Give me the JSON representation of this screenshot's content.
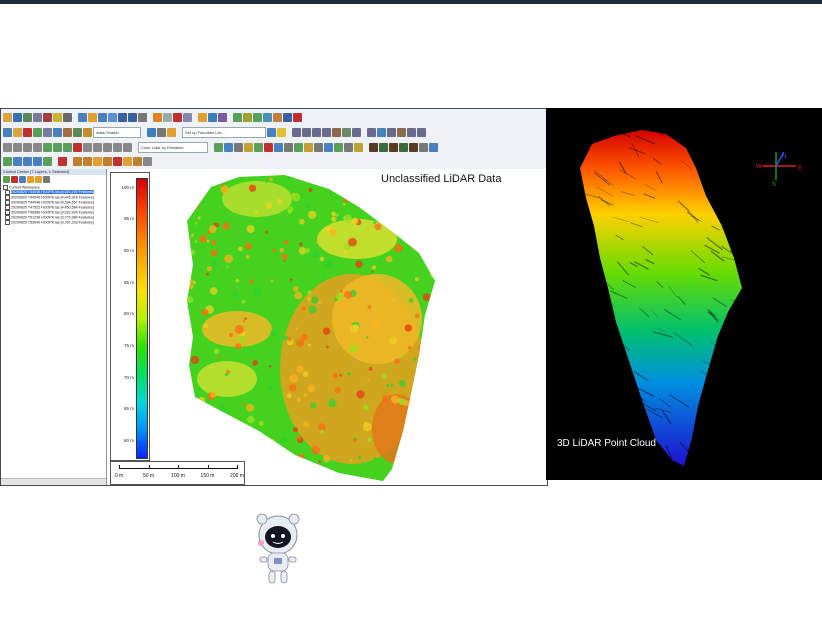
{
  "toolbar": {
    "style_select": "Atlas Shader",
    "favorites_select": "Set up Favorites List...",
    "color_select": "Color Lidar by Elevation"
  },
  "control_center": {
    "title": "Control Center [7 Layers, 1 Selected]",
    "workspace": "Current Workspace",
    "layers": [
      {
        "label": "20200820 T44046 HOOPK.las [4,520,160 Features]",
        "selected": true
      },
      {
        "label": "20200820 T44046 HOOPK.las [4,445,918 Features]",
        "selected": false
      },
      {
        "label": "20200820 T44046 HOOPK.las [4,594,557 Features]",
        "selected": false
      },
      {
        "label": "20200820 T47522 HOOPK.las [4,450,584 Features]",
        "selected": false
      },
      {
        "label": "20200820 T48366 HOOPK.las [3,032,924 Features]",
        "selected": false
      },
      {
        "label": "20200820 T51236 HOOPK.las [3,770,984 Features]",
        "selected": false
      },
      {
        "label": "20200820 T53040 HOOPK.las [3,767,233 Features]",
        "selected": false
      }
    ]
  },
  "map": {
    "title": "Unclassified LiDAR Data",
    "legend_ticks": [
      "100 m",
      "95 m",
      "90 m",
      "85 m",
      "80 m",
      "75 m",
      "70 m",
      "65 m",
      "60 m"
    ],
    "legend_values": [
      100,
      95,
      90,
      85,
      80,
      75,
      70,
      65,
      60
    ],
    "scale_labels": [
      "0 m",
      "50 m",
      "100 m",
      "150 m",
      "200 m"
    ],
    "scale_values": [
      0,
      50,
      100,
      150,
      200
    ]
  },
  "pointcloud": {
    "label": "3D LiDAR Point Cloud",
    "compass": {
      "n": "N",
      "e": "E",
      "w": "W",
      "s": "S"
    }
  },
  "colors": {
    "elevation_high": "#d40000",
    "elevation_mid": "#ffe000",
    "elevation_low": "#1020ff",
    "selection": "#3a78d8"
  }
}
